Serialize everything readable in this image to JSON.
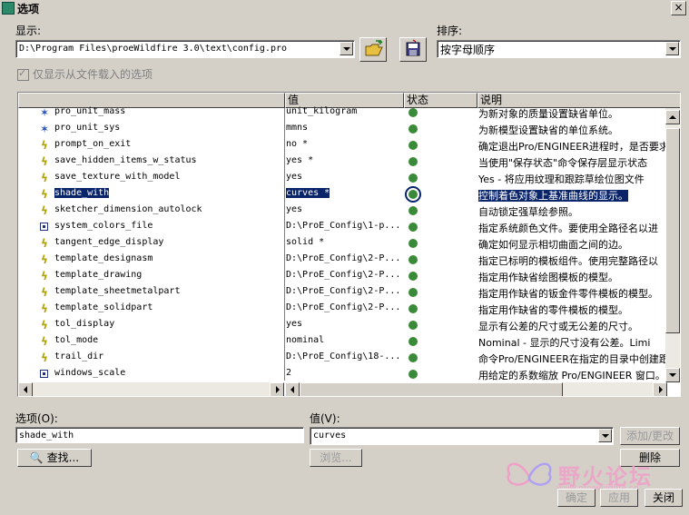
{
  "window": {
    "title": "选项",
    "close": "×"
  },
  "display": {
    "label": "显示:",
    "path": "D:\\Program Files\\proeWildfire 3.0\\text\\config.pro"
  },
  "sort": {
    "label": "排序:",
    "value": "按字母顺序"
  },
  "checkbox": {
    "label": "仅显示从文件载入的选项",
    "checked": true
  },
  "table": {
    "headers": [
      "",
      "值",
      "状态",
      "说明"
    ],
    "rows": [
      {
        "icon": "star",
        "name": "pro_unit_mass",
        "value": "unit_kilogram",
        "desc": "为新对象的质量设置缺省单位。"
      },
      {
        "icon": "star",
        "name": "pro_unit_sys",
        "value": "mmns",
        "desc": "为新模型设置缺省的单位系统。"
      },
      {
        "icon": "bolt",
        "name": "prompt_on_exit",
        "value": "no *",
        "desc": "确定退出Pro/ENGINEER进程时，是否要求"
      },
      {
        "icon": "bolt",
        "name": "save_hidden_items_w_status",
        "value": "yes *",
        "desc": "当使用\"保存状态\"命令保存层显示状态"
      },
      {
        "icon": "bolt",
        "name": "save_texture_with_model",
        "value": "yes",
        "desc": "Yes - 将应用纹理和跟踪草绘位图文件"
      },
      {
        "icon": "bolt",
        "name": "shade_with",
        "value": "curves *",
        "desc": "控制着色对象上基准曲线的显示。",
        "selected": true
      },
      {
        "icon": "bolt",
        "name": "sketcher_dimension_autolock",
        "value": "yes",
        "desc": "自动锁定强草绘参照。"
      },
      {
        "icon": "box",
        "name": "system_colors_file",
        "value": "D:\\ProE_Config\\1-p...",
        "desc": "指定系统颜色文件。要使用全路径名以进"
      },
      {
        "icon": "bolt",
        "name": "tangent_edge_display",
        "value": "solid *",
        "desc": "确定如何显示相切曲面之间的边。"
      },
      {
        "icon": "bolt",
        "name": "template_designasm",
        "value": "D:\\ProE_Config\\2-P...",
        "desc": "指定已标明的模板组件。使用完整路径以"
      },
      {
        "icon": "bolt",
        "name": "template_drawing",
        "value": "D:\\ProE_Config\\2-P...",
        "desc": "指定用作缺省绘图模板的模型。"
      },
      {
        "icon": "bolt",
        "name": "template_sheetmetalpart",
        "value": "D:\\ProE_Config\\2-P...",
        "desc": "指定用作缺省的钣金件零件模板的模型。"
      },
      {
        "icon": "bolt",
        "name": "template_solidpart",
        "value": "D:\\ProE_Config\\2-P...",
        "desc": "指定用作缺省的零件模板的模型。"
      },
      {
        "icon": "bolt",
        "name": "tol_display",
        "value": "yes",
        "desc": "显示有公差的尺寸或无公差的尺寸。"
      },
      {
        "icon": "bolt",
        "name": "tol_mode",
        "value": "nominal",
        "desc": "Nominal - 显示的尺寸没有公差。Limi"
      },
      {
        "icon": "bolt",
        "name": "trail_dir",
        "value": "D:\\ProE_Config\\18-...",
        "desc": "命令Pro/ENGINEER在指定的目录中创建跟"
      },
      {
        "icon": "box",
        "name": "windows_scale",
        "value": "2",
        "desc": "用给定的系数缩放 Pro/ENGINEER 窗口。"
      }
    ]
  },
  "option": {
    "label": "选项(O):",
    "value": "shade_with"
  },
  "value": {
    "label": "值(V):",
    "value": "curves"
  },
  "buttons": {
    "find": "查找...",
    "browse": "浏览...",
    "add_change": "添加/更改",
    "delete": "删除",
    "ok": "确定",
    "apply": "应用",
    "close": "关闭"
  },
  "watermark": {
    "text": "野火论坛",
    "url": "www.proewildfire.cn"
  },
  "colors": {
    "face": "#d4d0c8",
    "selection": "#0a246a",
    "status_dot": "#3a8a3a"
  }
}
